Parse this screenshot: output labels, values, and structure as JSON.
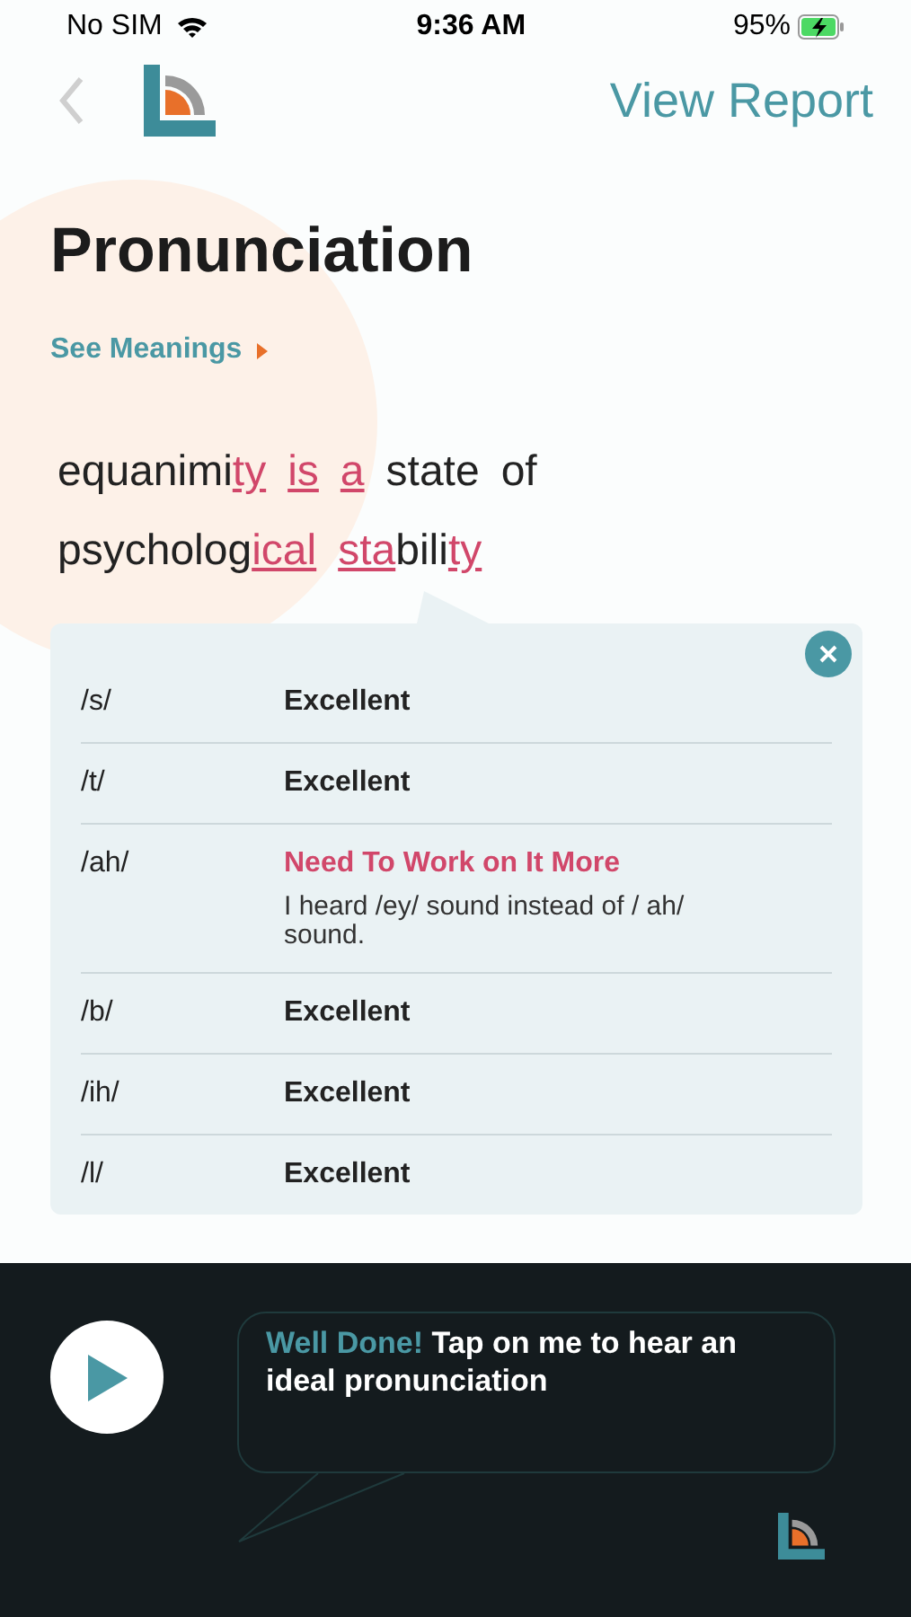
{
  "status_bar": {
    "carrier": "No SIM",
    "time": "9:36 AM",
    "battery": "95%"
  },
  "nav": {
    "action": "View Report"
  },
  "title": "Pronunciation",
  "meanings_link": "See Meanings",
  "sentence": [
    [
      {
        "segments": [
          {
            "text": "equanimi",
            "error": false
          },
          {
            "text": "ty",
            "error": true
          }
        ]
      },
      {
        "segments": [
          {
            "text": "is",
            "error": true
          }
        ]
      },
      {
        "segments": [
          {
            "text": "a",
            "error": true
          }
        ]
      },
      {
        "segments": [
          {
            "text": "state",
            "error": false
          }
        ]
      },
      {
        "segments": [
          {
            "text": "of",
            "error": false
          }
        ]
      }
    ],
    [
      {
        "segments": [
          {
            "text": "psycholog",
            "error": false
          },
          {
            "text": "ical",
            "error": true
          }
        ]
      },
      {
        "segments": [
          {
            "text": "sta",
            "error": true
          },
          {
            "text": "bili",
            "error": false
          },
          {
            "text": "ty",
            "error": true
          }
        ]
      }
    ]
  ],
  "phonemes": [
    {
      "phoneme": "/s/",
      "verdict": "Excellent",
      "kind": "good"
    },
    {
      "phoneme": "/t/",
      "verdict": "Excellent",
      "kind": "good"
    },
    {
      "phoneme": "/ah/",
      "verdict": "Need To Work on It More",
      "kind": "bad",
      "note": "I heard /ey/ sound instead of / ah/ sound."
    },
    {
      "phoneme": "/b/",
      "verdict": "Excellent",
      "kind": "good"
    },
    {
      "phoneme": "/ih/",
      "verdict": "Excellent",
      "kind": "good"
    },
    {
      "phoneme": "/l/",
      "verdict": "Excellent",
      "kind": "good"
    }
  ],
  "feedback": {
    "highlight": "Well Done!",
    "message": "Tap on me to hear an ideal pronunciation"
  }
}
